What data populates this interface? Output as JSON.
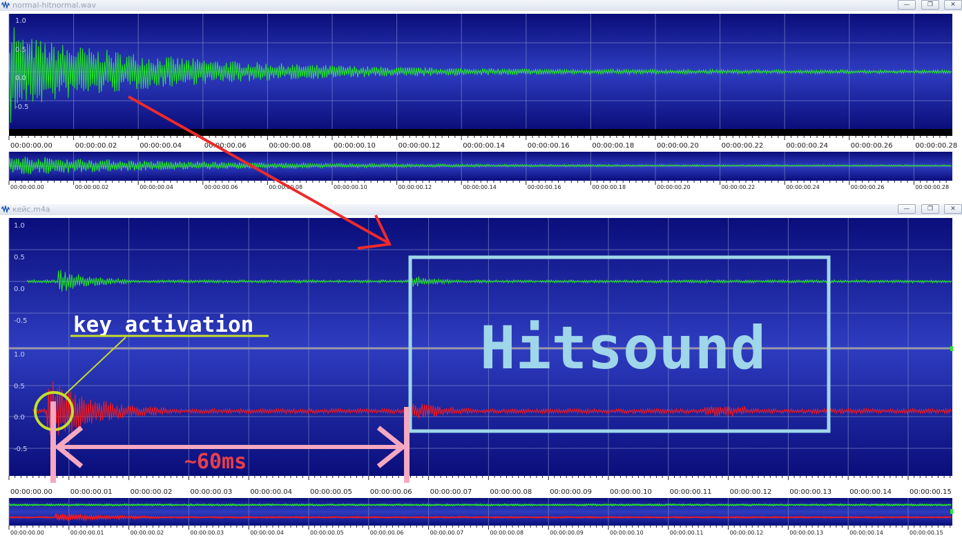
{
  "windows": [
    {
      "id": "w1",
      "title": "normal-hitnormal.wav",
      "buttons": [
        "—",
        "❐",
        "✕"
      ],
      "amp_labels": [
        "1.0",
        "0.5",
        "0.0",
        "-0.5"
      ],
      "time_labels": [
        "00:00:00.00",
        "00:00:00.02",
        "00:00:00.04",
        "00:00:00.06",
        "00:00:00.08",
        "00:00:00.10",
        "00:00:00.12",
        "00:00:00.14",
        "00:00:00.16",
        "00:00:00.18",
        "00:00:00.20",
        "00:00:00.22",
        "00:00:00.24",
        "00:00:00.26",
        "00:00:00.28"
      ],
      "overview_labels": [
        "00:00:00.00",
        "00:00:00.02",
        "00:00:00.04",
        "00:00:00.06",
        "00:00:00.08",
        "00:00:00.10",
        "00:00:00.12",
        "00:00:00.14",
        "00:00:00.16",
        "00:00:00.18",
        "00:00:00.20",
        "00:00:00.22",
        "00:00:00.24",
        "00:00:00.26",
        "00:00:00.28"
      ]
    },
    {
      "id": "w2",
      "title": "кейс.m4a",
      "buttons": [
        "—",
        "❐",
        "✕"
      ],
      "amp_labels_top": [
        "1.0",
        "0.5",
        "0.0",
        "-0.5"
      ],
      "amp_labels_bottom": [
        "1.0",
        "0.5",
        "0.0",
        "-0.5"
      ],
      "time_labels": [
        "00:00:00.00",
        "00:00:00.01",
        "00:00:00.02",
        "00:00:00.03",
        "00:00:00.04",
        "00:00:00.05",
        "00:00:00.06",
        "00:00:00.07",
        "00:00:00.08",
        "00:00:00.09",
        "00:00:00.10",
        "00:00:00.11",
        "00:00:00.12",
        "00:00:00.13",
        "00:00:00.14",
        "00:00:00.15"
      ],
      "overview_labels": [
        "00:00:00.00",
        "00:00:00.01",
        "00:00:00.02",
        "00:00:00.03",
        "00:00:00.04",
        "00:00:00.05",
        "00:00:00.06",
        "00:00:00.07",
        "00:00:00.08",
        "00:00:00.09",
        "00:00:00.10",
        "00:00:00.11",
        "00:00:00.12",
        "00:00:00.13",
        "00:00:00.14",
        "00:00:00.15"
      ]
    }
  ],
  "annotations": {
    "key_activation": "key activation",
    "hitsound": "Hitsound",
    "duration": "~60ms"
  },
  "colors": {
    "channel_left": "#22ee22",
    "channel_right": "#ff1a1a",
    "arrow": "#ee2a2a",
    "box": "#9fd6ea",
    "bracket": "#f6a8c0",
    "circle": "#c6dd2a",
    "duration_text": "#e8404a"
  }
}
